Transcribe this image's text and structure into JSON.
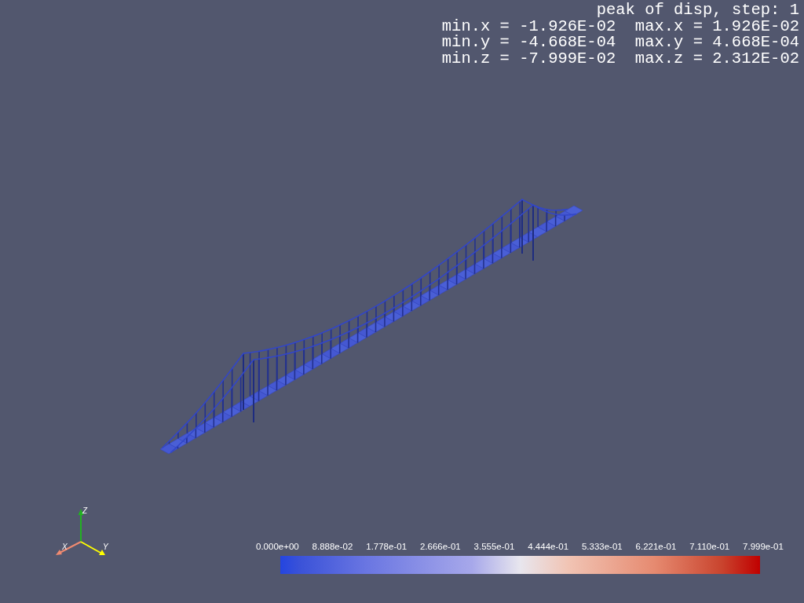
{
  "info_text": [
    "peak of disp, step: 1",
    "min.x = -1.926E-02  max.x = 1.926E-02",
    "min.y = -4.668E-04  max.y = 4.668E-04",
    "min.z = -7.999E-02  max.z = 2.312E-02"
  ],
  "axes": {
    "x": "X",
    "y": "Y",
    "z": "Z"
  },
  "scalar_bar": {
    "labels": [
      "0.000e+00",
      "8.888e-02",
      "1.778e-01",
      "2.666e-01",
      "3.555e-01",
      "4.444e-01",
      "5.333e-01",
      "6.221e-01",
      "7.110e-01",
      "7.999e-01"
    ]
  }
}
